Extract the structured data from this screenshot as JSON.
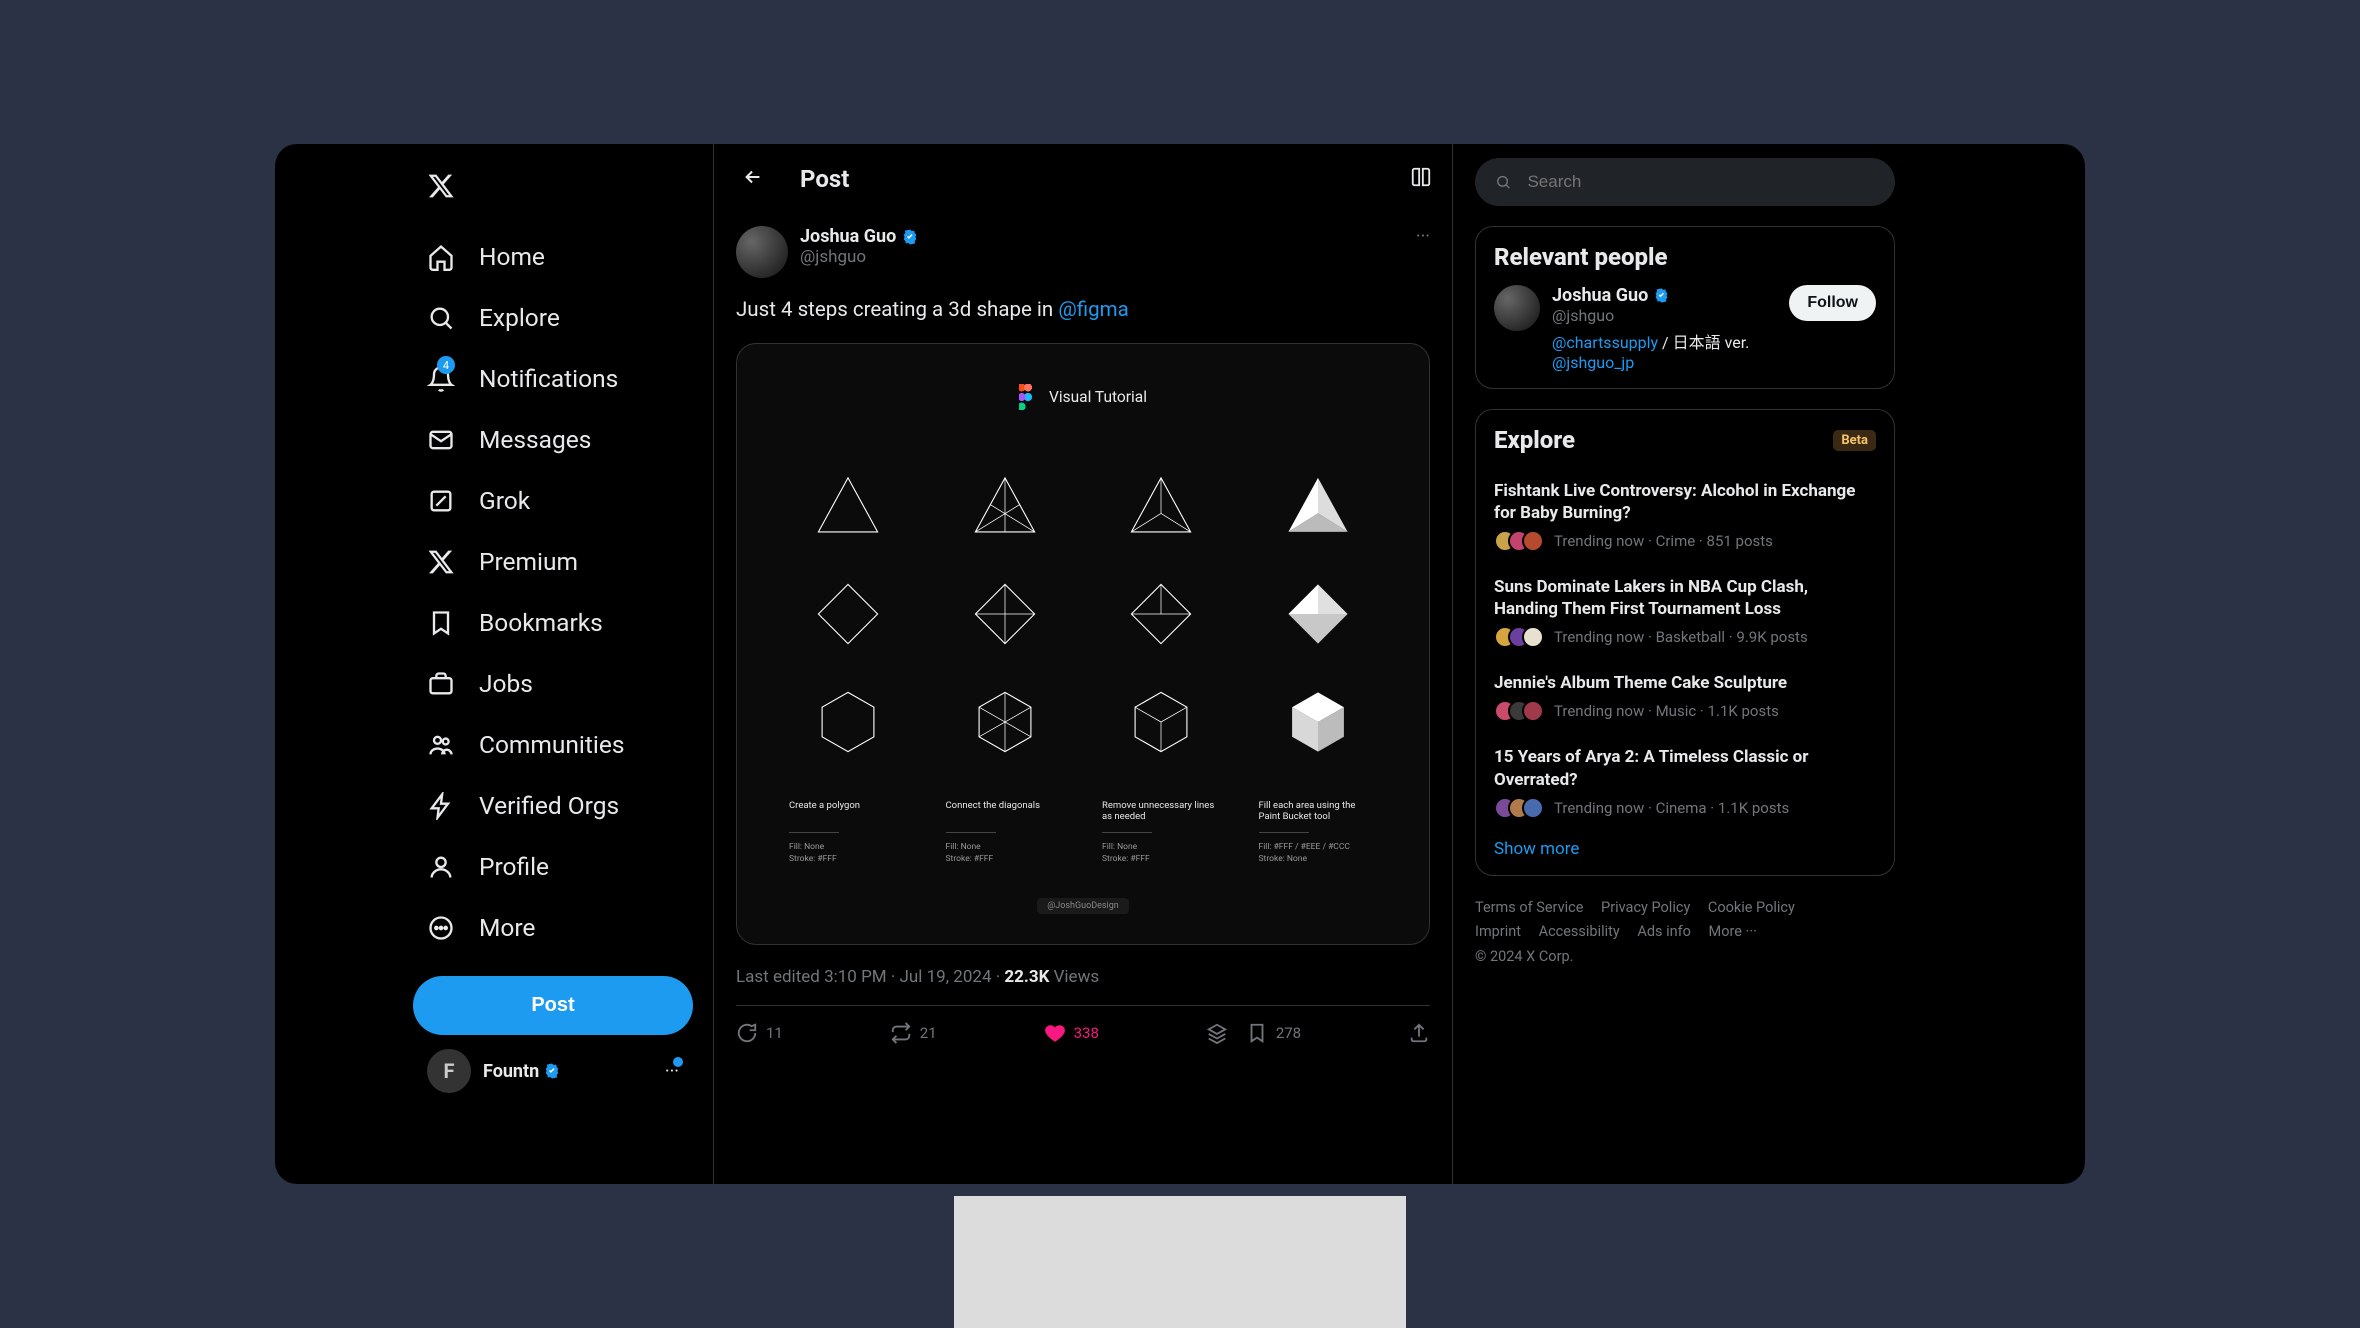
{
  "nav": {
    "home": "Home",
    "explore": "Explore",
    "notifications": "Notifications",
    "notif_badge": "4",
    "messages": "Messages",
    "grok": "Grok",
    "premium": "Premium",
    "bookmarks": "Bookmarks",
    "jobs": "Jobs",
    "communities": "Communities",
    "verified_orgs": "Verified Orgs",
    "profile": "Profile",
    "more": "More",
    "post_button": "Post",
    "account_name": "Fountn"
  },
  "center": {
    "page_title": "Post",
    "author_name": "Joshua Guo",
    "author_handle": "@jshguo",
    "post_text_pre": "Just 4 steps creating a 3d shape in ",
    "post_mention": "@figma",
    "media": {
      "header": "Visual Tutorial",
      "steps": [
        {
          "title": "Create a polygon",
          "fill": "Fill: None",
          "stroke": "Stroke: #FFF"
        },
        {
          "title": "Connect the diagonals",
          "fill": "Fill: None",
          "stroke": "Stroke: #FFF"
        },
        {
          "title": "Remove unnecessary lines as needed",
          "fill": "Fill: None",
          "stroke": "Stroke: #FFF"
        },
        {
          "title": "Fill each area using the Paint Bucket tool",
          "fill": "Fill: #FFF / #EEE / #CCC",
          "stroke": "Stroke: None"
        }
      ],
      "artist_tag": "@JoshGuoDesign"
    },
    "timestamp_prefix": "Last edited 3:10 PM · Jul 19, 2024 · ",
    "views_count": "22.3K",
    "views_label": " Views",
    "actions": {
      "replies": "11",
      "reposts": "21",
      "likes": "338",
      "bookmarks": "278"
    }
  },
  "right": {
    "search_placeholder": "Search",
    "relevant_title": "Relevant people",
    "person": {
      "name": "Joshua Guo",
      "handle": "@jshguo",
      "bio_link1": "@chartssupply",
      "bio_mid": " / 日本語 ver. ",
      "bio_link2": "@jshguo_jp",
      "follow": "Follow"
    },
    "explore_title": "Explore",
    "beta": "Beta",
    "trends": [
      {
        "title": "Fishtank Live Controversy: Alcohol in Exchange for Baby Burning?",
        "meta": "Trending now · Crime · 851 posts",
        "c1": "#caa24a",
        "c2": "#c4436d",
        "c3": "#b54a2f"
      },
      {
        "title": "Suns Dominate Lakers in NBA Cup Clash, Handing Them First Tournament Loss",
        "meta": "Trending now · Basketball · 9.9K posts",
        "c1": "#d6a53f",
        "c2": "#6a3fa0",
        "c3": "#e8e0d0"
      },
      {
        "title": "Jennie's Album Theme Cake Sculpture",
        "meta": "Trending now · Music · 1.1K posts",
        "c1": "#c94a6a",
        "c2": "#3a3a3a",
        "c3": "#a03a4a"
      },
      {
        "title": "15 Years of Arya 2: A Timeless Classic or Overrated?",
        "meta": "Trending now · Cinema · 1.1K posts",
        "c1": "#7a4a9a",
        "c2": "#b07a4a",
        "c3": "#4a6ab0"
      }
    ],
    "show_more": "Show more",
    "footer": {
      "tos": "Terms of Service",
      "privacy": "Privacy Policy",
      "cookie": "Cookie Policy",
      "imprint": "Imprint",
      "accessibility": "Accessibility",
      "ads": "Ads info",
      "more": "More ···",
      "copyright": "© 2024 X Corp."
    }
  }
}
